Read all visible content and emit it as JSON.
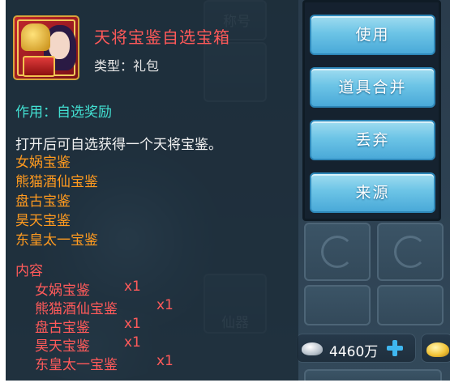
{
  "background": {
    "slot_label_top": "称号",
    "slot_label_bottom": "仙器"
  },
  "currency": {
    "silver_value": "4460万",
    "silver_icon": "silver-ingot-icon",
    "gold_icon": "gold-ingot-icon",
    "plus_icon": "plus-icon"
  },
  "tooltip": {
    "title": "天将宝鉴自选宝箱",
    "type": "类型：礼包",
    "effect": "作用：自选奖励",
    "description": "打开后可自选获得一个天将宝鉴。",
    "choices": [
      "女娲宝鉴",
      "熊猫酒仙宝鉴",
      "盘古宝鉴",
      "昊天宝鉴",
      "东皇太一宝鉴"
    ],
    "contents_header": "内容",
    "contents": [
      {
        "name": "女娲宝鉴",
        "qty": "x1"
      },
      {
        "name": "熊猫酒仙宝鉴",
        "qty": "x1"
      },
      {
        "name": "盘古宝鉴",
        "qty": "x1"
      },
      {
        "name": "昊天宝鉴",
        "qty": "x1"
      },
      {
        "name": "东皇太一宝鉴",
        "qty": "x1"
      }
    ]
  },
  "actions": {
    "use": "使用",
    "merge": "道具合并",
    "discard": "丢弃",
    "source": "来源"
  },
  "colors": {
    "title": "#ff5959",
    "effect": "#42e0d2",
    "choice": "#ff9a1f",
    "content": "#ff5a5a",
    "button": "#6cc4e6"
  }
}
